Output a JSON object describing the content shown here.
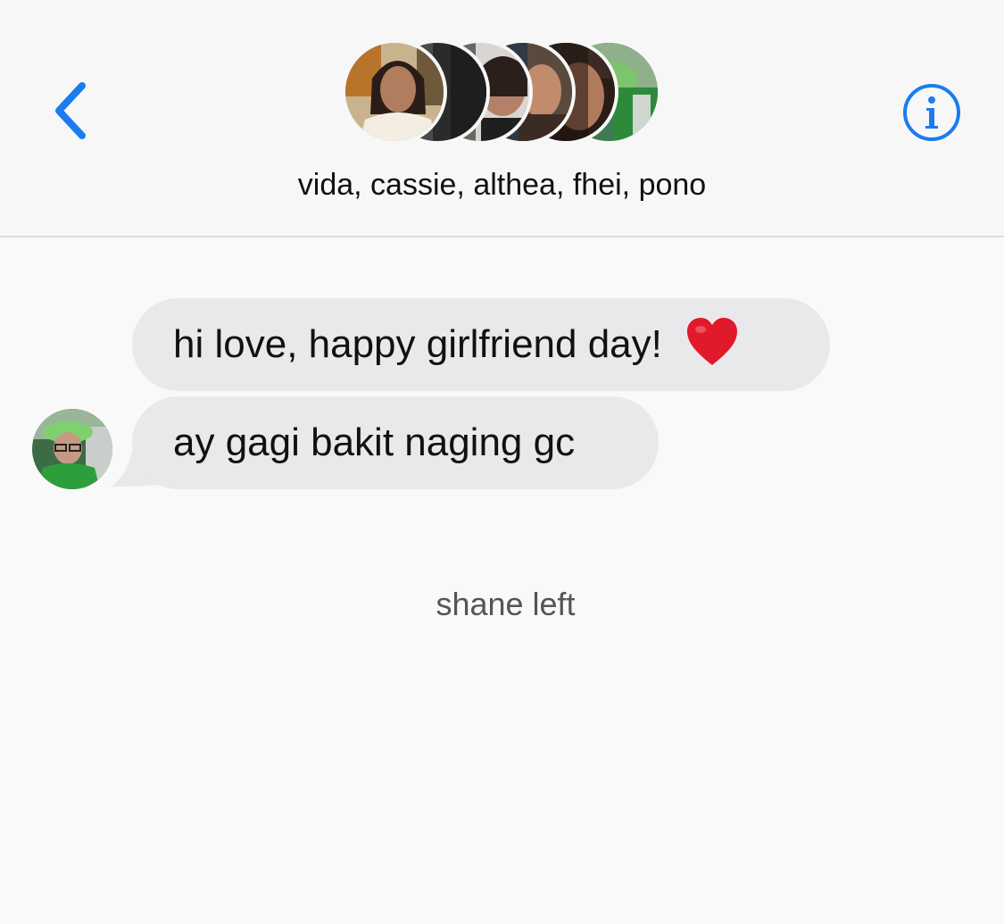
{
  "header": {
    "back_icon": "chevron-left-icon",
    "info_icon": "info-circle-icon",
    "accent_color": "#1a7cf0",
    "group_names": "vida, cassie, althea, fhei, pono",
    "avatars": [
      "vida",
      "cassie",
      "althea",
      "fhei",
      "pono"
    ]
  },
  "messages": [
    {
      "text": "hi love, happy girlfriend day!",
      "emoji": "red-heart-icon"
    },
    {
      "text": "ay gagi bakit naging gc"
    }
  ],
  "system": {
    "note": "shane left"
  },
  "colors": {
    "bubble_incoming": "#e9e9eb",
    "background": "#f9f9f9"
  }
}
